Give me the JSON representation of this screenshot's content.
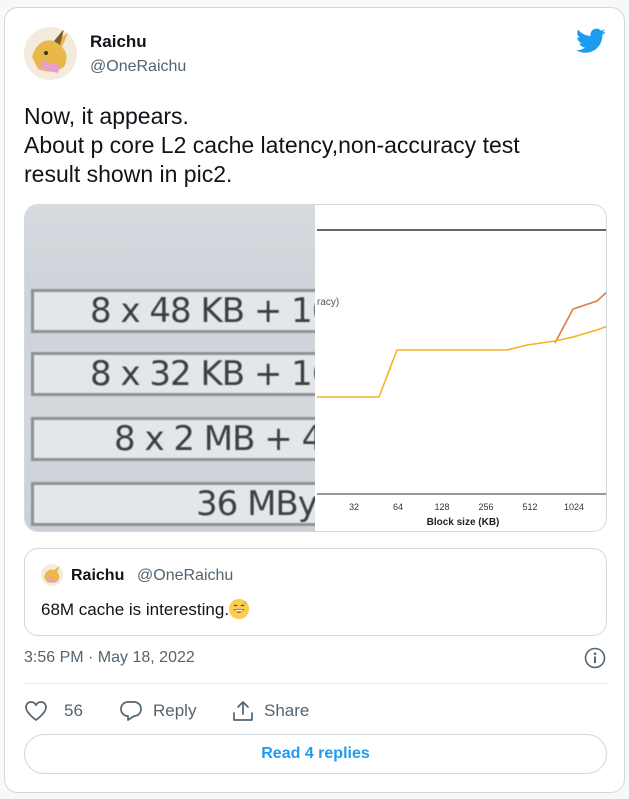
{
  "author": {
    "name": "Raichu",
    "handle": "@OneRaichu"
  },
  "tweet": {
    "lines": [
      "Now, it appears.",
      "About p core L2 cache latency,non-accuracy test",
      "result shown in pic2."
    ]
  },
  "media": {
    "pic1_rows": [
      "8 x 48 KB + 16",
      "8 x 32 KB + 16",
      "8 x 2 MB + 4",
      "36 MByt"
    ],
    "pic2": {
      "legend_fragment": "racy)",
      "x_ticks": [
        "32",
        "64",
        "128",
        "256",
        "512",
        "1024"
      ],
      "xlabel": "Block size (KB)",
      "colors": {
        "line_yellow": "#f5b324",
        "line_orange": "#e07b39",
        "axis": "#333333"
      }
    }
  },
  "quoted_tweet": {
    "name": "Raichu",
    "handle": "@OneRaichu",
    "text": "68M cache is interesting.",
    "emoji": "grinning-sweat-emoji"
  },
  "timestamp": "3:56 PM · May 18, 2022",
  "actions": {
    "like_count": "56",
    "reply_label": "Reply",
    "share_label": "Share"
  },
  "read_replies_label": "Read 4 replies",
  "colors": {
    "accent": "#1d9bf0",
    "secondary_text": "#536471",
    "border": "#cfd9de"
  }
}
